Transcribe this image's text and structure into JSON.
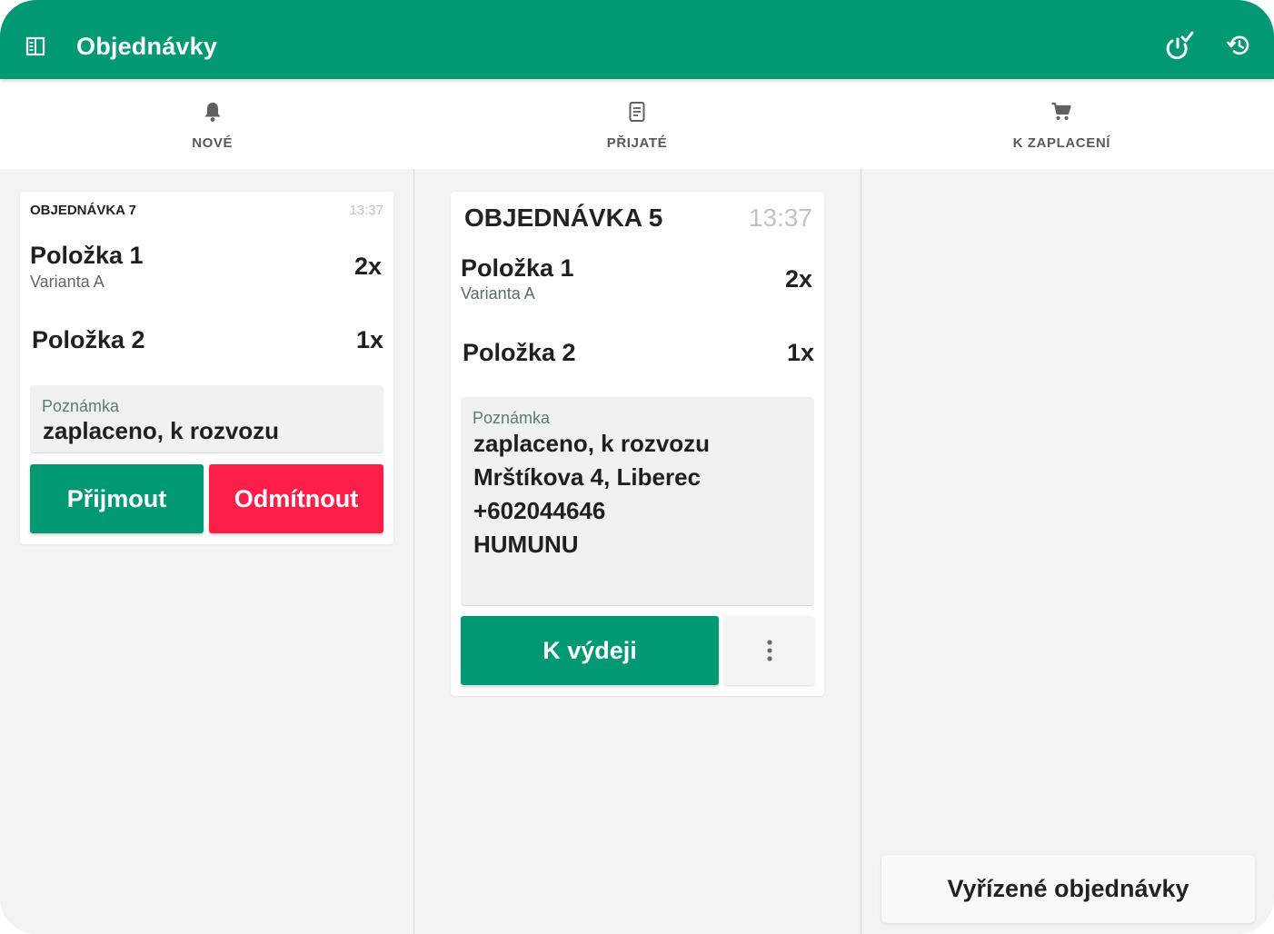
{
  "app": {
    "title": "Objednávky",
    "accent": "#019973",
    "danger": "#fd1e4a",
    "icons": {
      "menu": "menu-book-icon",
      "action1": "power-check-icon",
      "action2": "history-icon"
    }
  },
  "tabs": [
    {
      "label": "NOVÉ",
      "icon": "bell-icon"
    },
    {
      "label": "PŘIJATÉ",
      "icon": "receipt-icon"
    },
    {
      "label": "K ZAPLACENÍ",
      "icon": "cart-icon"
    }
  ],
  "new_order": {
    "title": "OBJEDNÁVKA 7",
    "time": "13:37",
    "items": [
      {
        "name": "Položka 1",
        "variant": "Varianta A",
        "qty": "2x"
      },
      {
        "name": "Položka 2",
        "variant": "",
        "qty": "1x"
      }
    ],
    "note_label": "Poznámka",
    "note_text": "zaplaceno, k rozvozu",
    "accept_label": "Přijmout",
    "reject_label": "Odmítnout"
  },
  "accepted_order": {
    "title": "OBJEDNÁVKA 5",
    "time": "13:37",
    "items": [
      {
        "name": "Položka 1",
        "variant": "Varianta A",
        "qty": "2x"
      },
      {
        "name": "Položka 2",
        "variant": "",
        "qty": "1x"
      }
    ],
    "note_label": "Poznámka",
    "note_lines": [
      "zaplaceno, k rozvozu",
      "Mrštíkova 4, Liberec",
      "+602044646",
      "HUMUNU"
    ],
    "dispatch_label": "K výdeji",
    "more_icon": "more-vert-icon"
  },
  "payment_column": {
    "done_orders_label": "Vyřízené objednávky"
  }
}
